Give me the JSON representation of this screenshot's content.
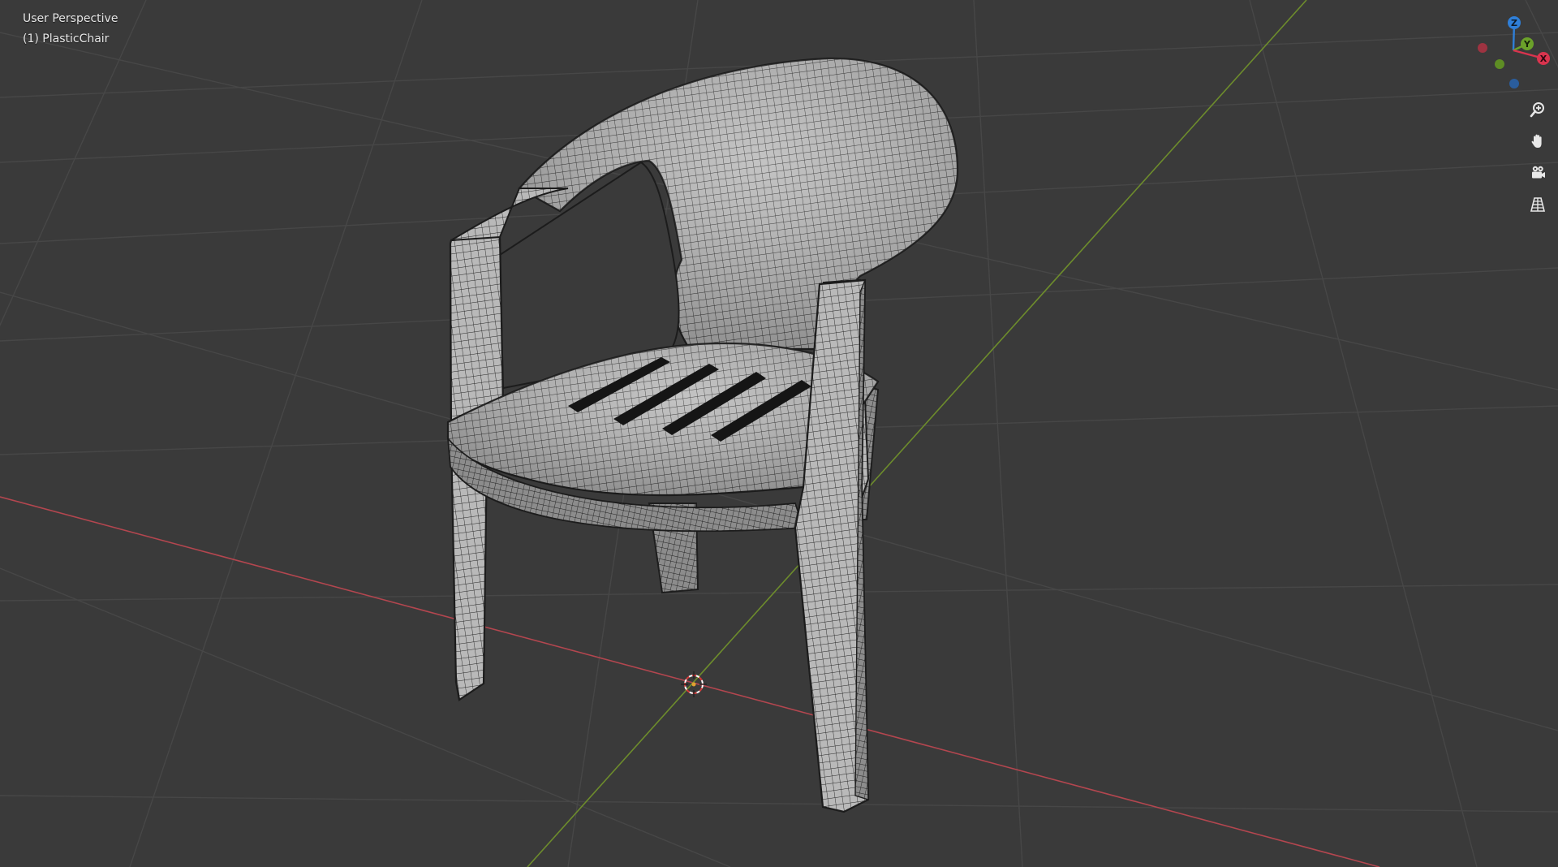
{
  "viewport": {
    "view_mode": "User Perspective",
    "object_label": "(1) PlasticChair"
  },
  "gizmo": {
    "axes": [
      {
        "name": "z",
        "label": "Z",
        "color": "#2f7fd8"
      },
      {
        "name": "y",
        "label": "Y",
        "color": "#6ba12a"
      },
      {
        "name": "x",
        "label": "X",
        "color": "#d9344e"
      }
    ]
  },
  "nav_tools": [
    {
      "name": "zoom",
      "icon": "zoom-icon"
    },
    {
      "name": "pan",
      "icon": "hand-icon"
    },
    {
      "name": "camera",
      "icon": "camera-icon"
    },
    {
      "name": "perspective",
      "icon": "grid-icon"
    }
  ],
  "colors": {
    "background": "#3a3a3a",
    "grid_line": "#484848",
    "x_axis": "#b3464f",
    "y_axis": "#6d8c2c",
    "mesh_fill": "#b8b8b8",
    "mesh_wire": "#2a2a2a"
  }
}
